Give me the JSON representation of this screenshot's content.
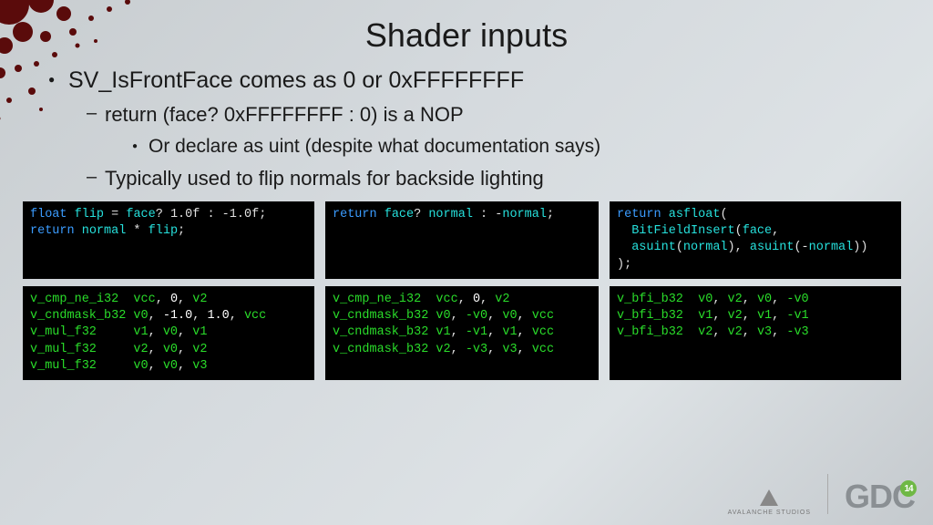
{
  "title": "Shader inputs",
  "bullets": {
    "l1": "SV_IsFrontFace comes as 0 or 0xFFFFFFFF",
    "l2a": "return (face? 0xFFFFFFFF : 0) is a NOP",
    "l3": "Or declare as uint (despite what documentation says)",
    "l2b": "Typically used to flip normals for backside lighting"
  },
  "code": {
    "c1": {
      "t1": "float",
      "t2": "flip",
      "t3": " = ",
      "t4": "face",
      "t5": "? ",
      "t6": "1.0f",
      " t7": " : ",
      "t8": "-1.0f",
      "t9": ";",
      "r1": "return",
      "r2": "normal",
      "r3": " * ",
      "r4": "flip",
      "r5": ";"
    },
    "c2": {
      "r1": "return",
      "r2": "face",
      "r3": "? ",
      "r4": "normal",
      "r5": " : -",
      "r6": "normal",
      "r7": ";"
    },
    "c3": {
      "r1": "return",
      "f1": "asfloat",
      "p1": "(",
      "f2": "BitFieldInsert",
      "p2": "(",
      "a1": "face",
      "c": ",",
      "f3": "asuint",
      "p3": "(",
      "a2": "normal",
      "p4": "), ",
      "f4": "asuint",
      "p5": "(-",
      "a3": "normal",
      "p6": "))",
      "p7": ");"
    },
    "a1": {
      "l1a": "v_cmp_ne_i32  ",
      "l1b": "vcc",
      "l1c": ", ",
      "l1d": "0",
      "l1e": ", ",
      "l1f": "v2",
      "l2a": "v_cndmask_b32 ",
      "l2b": "v0",
      "l2c": ", ",
      "l2d": "-1.0",
      "l2e": ", ",
      "l2f": "1.0",
      "l2g": ", ",
      "l2h": "vcc",
      "l3a": "v_mul_f32     ",
      "l3b": "v1",
      "l3c": ", ",
      "l3d": "v0",
      "l3e": ", ",
      "l3f": "v1",
      "l4a": "v_mul_f32     ",
      "l4b": "v2",
      "l4c": ", ",
      "l4d": "v0",
      "l4e": ", ",
      "l4f": "v2",
      "l5a": "v_mul_f32     ",
      "l5b": "v0",
      "l5c": ", ",
      "l5d": "v0",
      "l5e": ", ",
      "l5f": "v3"
    },
    "a2": {
      "l1a": "v_cmp_ne_i32  ",
      "l1b": "vcc",
      "l1c": ", ",
      "l1d": "0",
      "l1e": ", ",
      "l1f": "v2",
      "l2a": "v_cndmask_b32 ",
      "l2b": "v0",
      "l2c": ", ",
      "l2d": "-v0",
      "l2e": ", ",
      "l2f": "v0",
      "l2g": ", ",
      "l2h": "vcc",
      "l3a": "v_cndmask_b32 ",
      "l3b": "v1",
      "l3c": ", ",
      "l3d": "-v1",
      "l3e": ", ",
      "l3f": "v1",
      "l3g": ", ",
      "l3h": "vcc",
      "l4a": "v_cndmask_b32 ",
      "l4b": "v2",
      "l4c": ", ",
      "l4d": "-v3",
      "l4e": ", ",
      "l4f": "v3",
      "l4g": ", ",
      "l4h": "vcc"
    },
    "a3": {
      "l1a": "v_bfi_b32  ",
      "l1b": "v0",
      "l1c": ", ",
      "l1d": "v2",
      "l1e": ", ",
      "l1f": "v0",
      "l1g": ", ",
      "l1h": "-v0",
      "l2a": "v_bfi_b32  ",
      "l2b": "v1",
      "l2c": ", ",
      "l2d": "v2",
      "l2e": ", ",
      "l2f": "v1",
      "l2g": ", ",
      "l2h": "-v1",
      "l3a": "v_bfi_b32  ",
      "l3b": "v2",
      "l3c": ", ",
      "l3d": "v2",
      "l3e": ", ",
      "l3f": "v3",
      "l3g": ", ",
      "l3h": "-v3"
    }
  },
  "logos": {
    "avalanche": "AVALANCHE STUDIOS",
    "gdc": "GDC",
    "year": "14"
  }
}
